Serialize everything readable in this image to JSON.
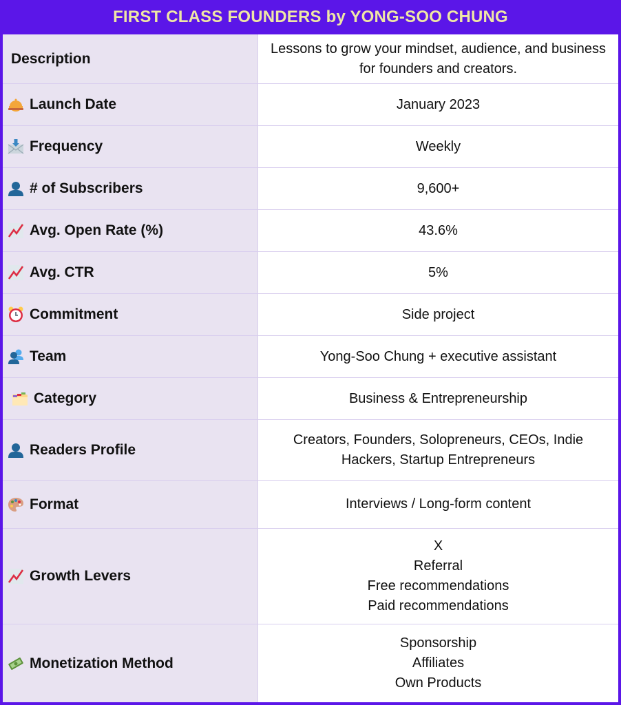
{
  "title": "FIRST CLASS FOUNDERS by YONG-SOO CHUNG",
  "colors": {
    "frame": "#5b16e8",
    "title_text": "#efe7a5",
    "label_bg": "#e9e3f1",
    "value_bg": "#ffffff",
    "divider": "#d8cdee"
  },
  "rows": [
    {
      "icon": "none",
      "label": "Description",
      "values": [
        "Lessons to grow your mindset, audience, and business",
        "for founders and creators."
      ]
    },
    {
      "icon": "bellhop-bell-icon",
      "label": "Launch Date",
      "values": [
        "January 2023"
      ]
    },
    {
      "icon": "envelope-arrow-icon",
      "label": "Frequency",
      "values": [
        "Weekly"
      ]
    },
    {
      "icon": "person-silhouette-icon",
      "label": "# of Subscribers",
      "values": [
        "9,600+"
      ]
    },
    {
      "icon": "chart-increasing-icon",
      "label": "Avg. Open Rate (%)",
      "values": [
        "43.6%"
      ]
    },
    {
      "icon": "chart-increasing-icon",
      "label": "Avg. CTR",
      "values": [
        "5%"
      ]
    },
    {
      "icon": "alarm-clock-icon",
      "label": "Commitment",
      "values": [
        "Side project"
      ]
    },
    {
      "icon": "people-silhouette-icon",
      "label": "Team",
      "values": [
        "Yong-Soo Chung + executive assistant"
      ]
    },
    {
      "icon": "card-index-dividers-icon",
      "label": "Category",
      "values": [
        "Business & Entrepreneurship"
      ]
    },
    {
      "icon": "person-silhouette-icon",
      "label": "Readers Profile",
      "values": [
        "Creators, Founders, Solopreneurs, CEOs, Indie",
        "Hackers, Startup Entrepreneurs"
      ]
    },
    {
      "icon": "artist-palette-icon",
      "label": "Format",
      "values": [
        "Interviews / Long-form content"
      ]
    },
    {
      "icon": "chart-increasing-icon",
      "label": "Growth Levers",
      "values": [
        "X",
        "Referral",
        "Free recommendations",
        "Paid recommendations"
      ]
    },
    {
      "icon": "money-with-wings-icon",
      "label": "Monetization Method",
      "values": [
        "Sponsorship",
        "Affiliates",
        "Own Products"
      ]
    }
  ]
}
